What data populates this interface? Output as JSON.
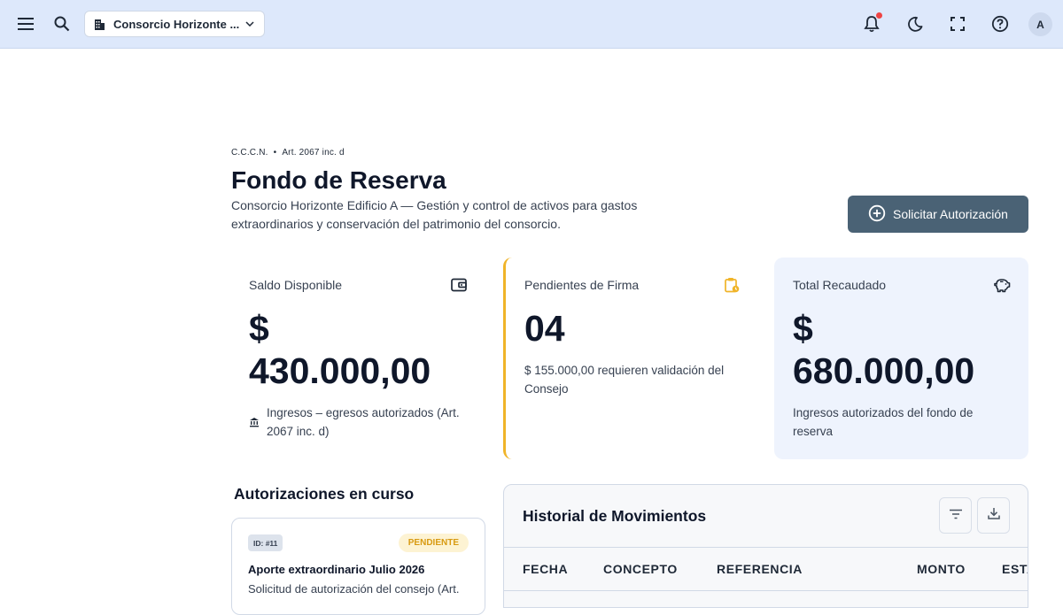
{
  "topbar": {
    "consortium_selector": "Consorcio Horizonte ...",
    "avatar_initial": "A",
    "notification_dot_color": "#ef4444"
  },
  "header": {
    "breadcrumb_law": "C.C.C.N.",
    "breadcrumb_sep": "•",
    "breadcrumb_article": "Art. 2067 inc. d",
    "title": "Fondo de Reserva",
    "subtitle": "Consorcio Horizonte Edificio A — Gestión y control de activos para gastos extraordinarios y conservación del patrimonio del consorcio.",
    "primary_button": "Solicitar Autorización"
  },
  "stats": {
    "available": {
      "label": "Saldo Disponible",
      "value_line1": "$",
      "value_line2": "430.000,00",
      "note": "Ingresos – egresos autorizados (Art. 2067 inc. d)"
    },
    "pending": {
      "label": "Pendientes de Firma",
      "value": "04",
      "note": "$ 155.000,00 requieren validación del Consejo"
    },
    "collected": {
      "label": "Total Recaudado",
      "value_line1": "$",
      "value_line2": "680.000,00",
      "note": "Ingresos autorizados del fondo de reserva"
    }
  },
  "authorizations": {
    "section_title": "Autorizaciones en curso",
    "items": [
      {
        "id": "ID: #11",
        "status": "PENDIENTE",
        "title": "Aporte extraordinario Julio 2026",
        "description": "Solicitud de autorización del consejo (Art."
      }
    ]
  },
  "history": {
    "title": "Historial de Movimientos",
    "columns": [
      "FECHA",
      "CONCEPTO",
      "REFERENCIA",
      "MONTO",
      "ESTA"
    ]
  },
  "colors": {
    "topbar_bg": "#dde8fb",
    "primary_button_bg": "#4a6275",
    "pending_accent": "#f0b429",
    "collected_card_bg": "#eef3fd"
  }
}
